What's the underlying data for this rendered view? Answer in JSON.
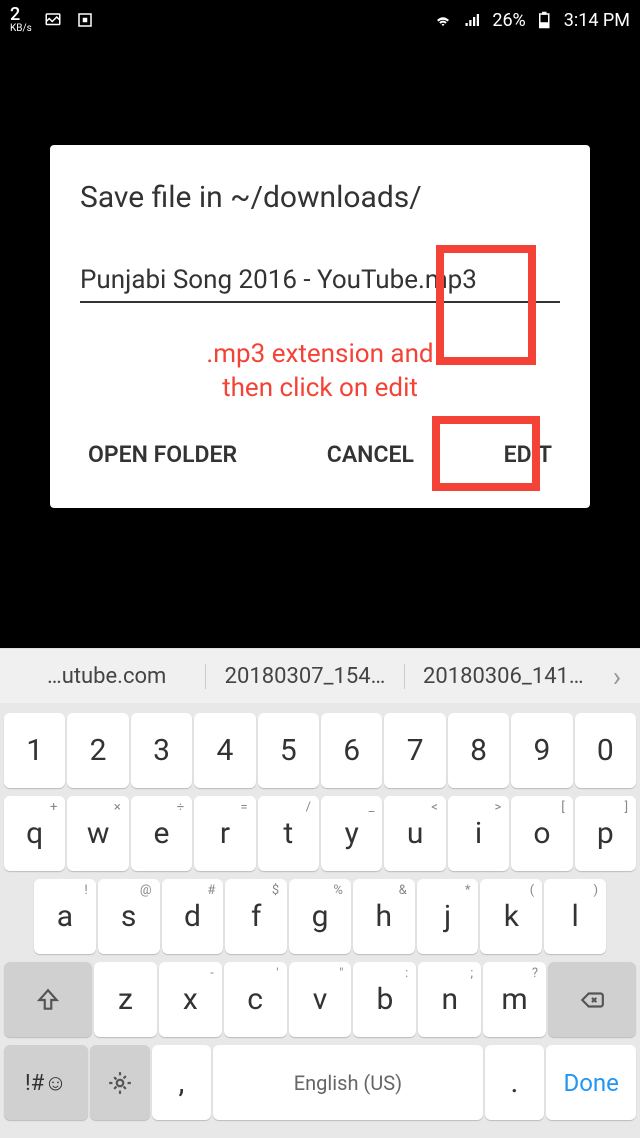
{
  "statusbar": {
    "kbs_value": "2",
    "kbs_unit": "KB/s",
    "battery_pct": "26%",
    "time": "3:14 PM"
  },
  "dialog": {
    "title": "Save file in ~/downloads/",
    "filename": "Punjabi Song 2016 - YouTube.mp3",
    "annotation_line1": ".mp3 extension and",
    "annotation_line2": "then click on edit",
    "btn_open": "OPEN FOLDER",
    "btn_cancel": "CANCEL",
    "btn_edit": "EDIT"
  },
  "suggestions": {
    "item1": "…utube.com",
    "item2": "20180307_154…",
    "item3": "20180306_141…"
  },
  "keyboard": {
    "row1": [
      "1",
      "2",
      "3",
      "4",
      "5",
      "6",
      "7",
      "8",
      "9",
      "0"
    ],
    "row2_keys": [
      "q",
      "w",
      "e",
      "r",
      "t",
      "y",
      "u",
      "i",
      "o",
      "p"
    ],
    "row2_hints": [
      "+",
      "×",
      "÷",
      "=",
      "/",
      "_",
      "<",
      ">",
      "[",
      "]"
    ],
    "row3_keys": [
      "a",
      "s",
      "d",
      "f",
      "g",
      "h",
      "j",
      "k",
      "l"
    ],
    "row3_hints": [
      "!",
      "@",
      "#",
      "$",
      "%",
      "&",
      "*",
      "(",
      ")"
    ],
    "row4_keys": [
      "z",
      "x",
      "c",
      "v",
      "b",
      "n",
      "m"
    ],
    "row4_hints": [
      "",
      "-",
      "'",
      "\"",
      ":",
      ";",
      "?"
    ],
    "sym": "!#☺",
    "comma": ",",
    "space": "English (US)",
    "period": ".",
    "done": "Done"
  }
}
